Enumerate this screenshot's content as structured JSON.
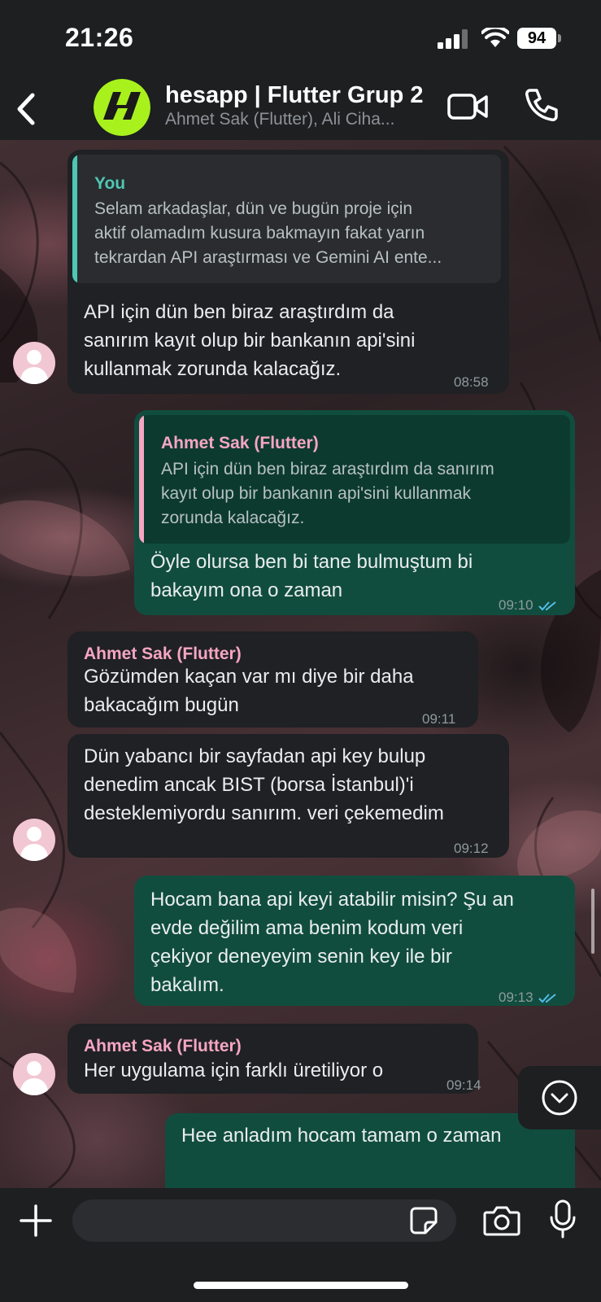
{
  "status_bar": {
    "time": "21:26",
    "battery": "94"
  },
  "header": {
    "title": "hesapp | Flutter Grup 2",
    "subtitle": "Ahmet Sak (Flutter), Ali Ciha...",
    "accent": "#a8f11d"
  },
  "messages": [
    {
      "direction": "incoming",
      "quote_author": "You",
      "quote_lines": [
        "Selam arkadaşlar, dün ve bugün proje için",
        "aktif olamadım kusura bakmayın fakat yarın",
        "tekrardan API araştırması ve Gemini AI ente..."
      ],
      "lines": [
        "API için dün ben biraz araştırdım da",
        "sanırım kayıt olup bir bankanın api'sini",
        "kullanmak zorunda kalacağız."
      ],
      "time": "08:58"
    },
    {
      "direction": "outgoing",
      "quote_author": "Ahmet Sak (Flutter)",
      "quote_lines": [
        "API için dün ben biraz araştırdım da sanırım",
        "kayıt olup bir bankanın api'sini kullanmak",
        "zorunda kalacağız."
      ],
      "lines": [
        "Öyle olursa ben bi tane bulmuştum bi",
        "bakayım ona o zaman"
      ],
      "time": "09:10"
    },
    {
      "direction": "incoming",
      "sender": "Ahmet Sak (Flutter)",
      "lines": [
        "Gözümden kaçan var mı diye bir daha",
        "bakacağım bugün"
      ],
      "time": "09:11"
    },
    {
      "direction": "incoming",
      "lines": [
        "Dün yabancı bir sayfadan api key bulup",
        "denedim ancak BIST (borsa İstanbul)'i",
        "desteklemiyordu sanırım. veri çekemedim"
      ],
      "time": "09:12"
    },
    {
      "direction": "outgoing",
      "lines": [
        "Hocam bana api keyi atabilir misin? Şu an",
        "evde değilim ama benim kodum veri",
        "çekiyor deneyeyim senin key ile bir",
        "bakalım."
      ],
      "time": "09:13"
    },
    {
      "direction": "incoming",
      "sender": "Ahmet Sak (Flutter)",
      "lines": [
        "Her uygulama için farklı üretiliyor o"
      ],
      "time": "09:14"
    },
    {
      "direction": "outgoing",
      "lines": [
        "Hee anladım hocam tamam o zaman"
      ]
    }
  ],
  "composer": {
    "placeholder": ""
  },
  "colors": {
    "incoming_bubble": "#1f2124",
    "outgoing_bubble": "#114d3e",
    "sender_name": "#f6a6c1",
    "quote_you": "#4fc7b4",
    "read_ticks": "#53bdeb"
  }
}
